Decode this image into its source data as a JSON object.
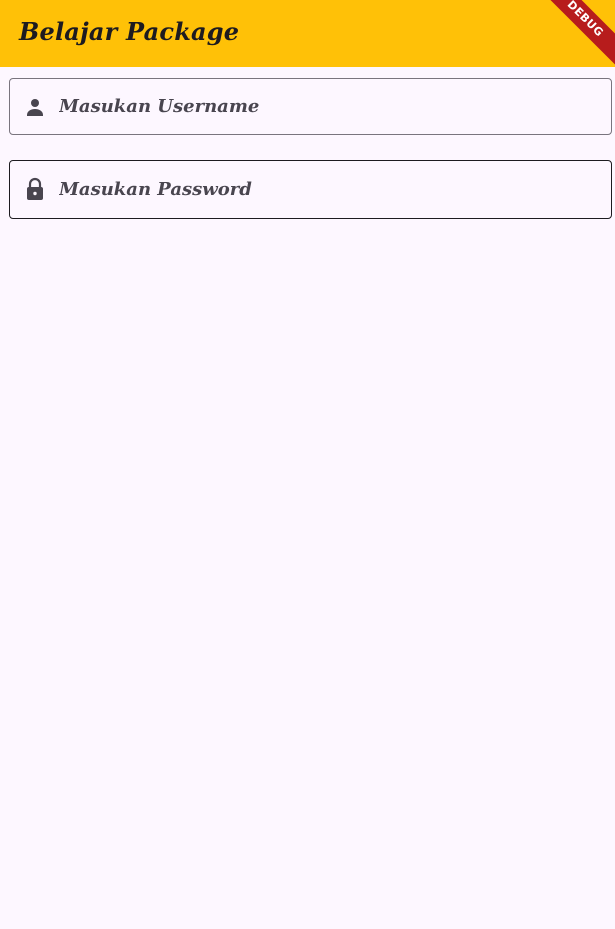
{
  "appbar": {
    "title": "Belajar Package",
    "background_color": "#ffc107"
  },
  "debug_banner": {
    "label": "DEBUG",
    "color": "#b71c1c"
  },
  "form": {
    "username": {
      "placeholder": "Masukan Username",
      "value": "",
      "icon": "person-icon"
    },
    "password": {
      "placeholder": "Masukan Password",
      "value": "",
      "icon": "lock-icon"
    }
  },
  "colors": {
    "page_background": "#fdf7ff",
    "text": "#1d1b20",
    "hint_text": "#49454f",
    "outline": "#79747e"
  }
}
